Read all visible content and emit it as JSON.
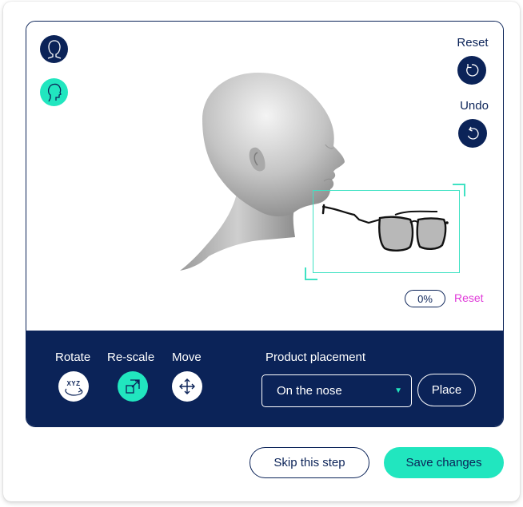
{
  "viewport": {
    "view_buttons": [
      {
        "name": "front-view",
        "icon": "head-front-icon"
      },
      {
        "name": "side-view",
        "icon": "head-side-icon"
      }
    ],
    "reset_label": "Reset",
    "undo_label": "Undo",
    "zoom_value": "0%",
    "zoom_reset_label": "Reset"
  },
  "toolbar": {
    "rotate_label": "Rotate",
    "rotate_icon_text": "XYZ",
    "rescale_label": "Re-scale",
    "move_label": "Move",
    "placement_label": "Product placement",
    "placement_selected": "On the nose",
    "place_label": "Place"
  },
  "footer": {
    "skip_label": "Skip this step",
    "save_label": "Save changes"
  },
  "colors": {
    "navy": "#0b2358",
    "accent_teal": "#21e6bf",
    "highlight_magenta": "#e03ad9"
  }
}
